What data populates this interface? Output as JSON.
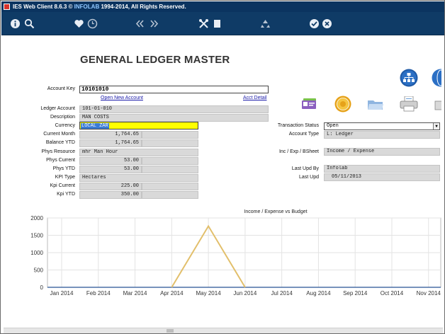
{
  "window": {
    "title_prefix": "IES Web Client 8.6.3 © ",
    "title_company": "INFOLAB",
    "title_suffix": " 1994-2014, All Rights Reserved."
  },
  "toolbar": {
    "icons": [
      "info-icon",
      "search-icon",
      "favorite-icon",
      "history-icon",
      "previous-icon",
      "next-icon",
      "tools-icon",
      "new-record-icon",
      "recycle-icon",
      "confirm-icon",
      "cancel-icon"
    ]
  },
  "page": {
    "title": "GENERAL LEDGER MASTER"
  },
  "form": {
    "account_key_label": "Account Key",
    "account_key_value": "10101010",
    "open_new_account_link": "Open New Account",
    "acct_detail_link": "Acct Detail",
    "ledger_account_label": "Ledger Account",
    "ledger_account_value": "101-01-010",
    "description_label": "Description",
    "description_value": "MAN COSTS",
    "currency_label": "Currency",
    "currency_value": "LOCAL ZAR",
    "current_month_label": "Current Month",
    "current_month_value": "1,764.65",
    "balance_ytd_label": "Balance YTD",
    "balance_ytd_value": "1,764.65",
    "phys_resource_label": "Phys Resource",
    "phys_resource_value": "mhr Man Hour",
    "phys_current_label": "Phys Current",
    "phys_current_value": "53.00",
    "phys_ytd_label": "Phys YTD",
    "phys_ytd_value": "53.00",
    "kpi_type_label": "KPI Type",
    "kpi_type_value": "Hectares",
    "kpi_current_label": "Kpi Current",
    "kpi_current_value": "225.00",
    "kpi_ytd_label": "Kpi YTD",
    "kpi_ytd_value": "350.00",
    "transaction_status_label": "Transaction Status",
    "transaction_status_value": "Open",
    "account_type_label": "Account Type",
    "account_type_value": "L: Ledger",
    "inc_exp_label": "Inc / Exp / BSheet",
    "inc_exp_value": "Income / Expense",
    "last_upd_by_label": "Last Upd By",
    "last_upd_by_value": "Infolab",
    "last_upd_label": "Last Upd",
    "last_upd_value": "05/11/2013"
  },
  "right_icons": [
    "org-chart-icon",
    "globe-icon",
    "id-card-icon",
    "seal-icon",
    "folder-icon",
    "printer-icon",
    "more-icon"
  ],
  "chart_data": {
    "type": "line",
    "title": "Income / Expense vs Budget",
    "categories": [
      "Jan 2014",
      "Feb 2014",
      "Mar 2014",
      "Apr 2014",
      "May 2014",
      "Jun 2014",
      "Jul 2014",
      "Aug 2014",
      "Sep 2014",
      "Oct 2014",
      "Nov 2014"
    ],
    "series": [
      {
        "values": [
          0,
          0,
          0,
          0,
          1764.65,
          0,
          0,
          0,
          0,
          0,
          0
        ],
        "color": "#e2bf6b"
      },
      {
        "values": [
          0,
          0,
          0,
          0,
          0,
          0,
          0,
          0,
          0,
          0,
          0
        ],
        "color": "#4a6fa5"
      }
    ],
    "yticks": [
      "0",
      "500",
      "1000",
      "1500",
      "2000"
    ],
    "ylim": [
      0,
      2000
    ],
    "grid": true
  }
}
